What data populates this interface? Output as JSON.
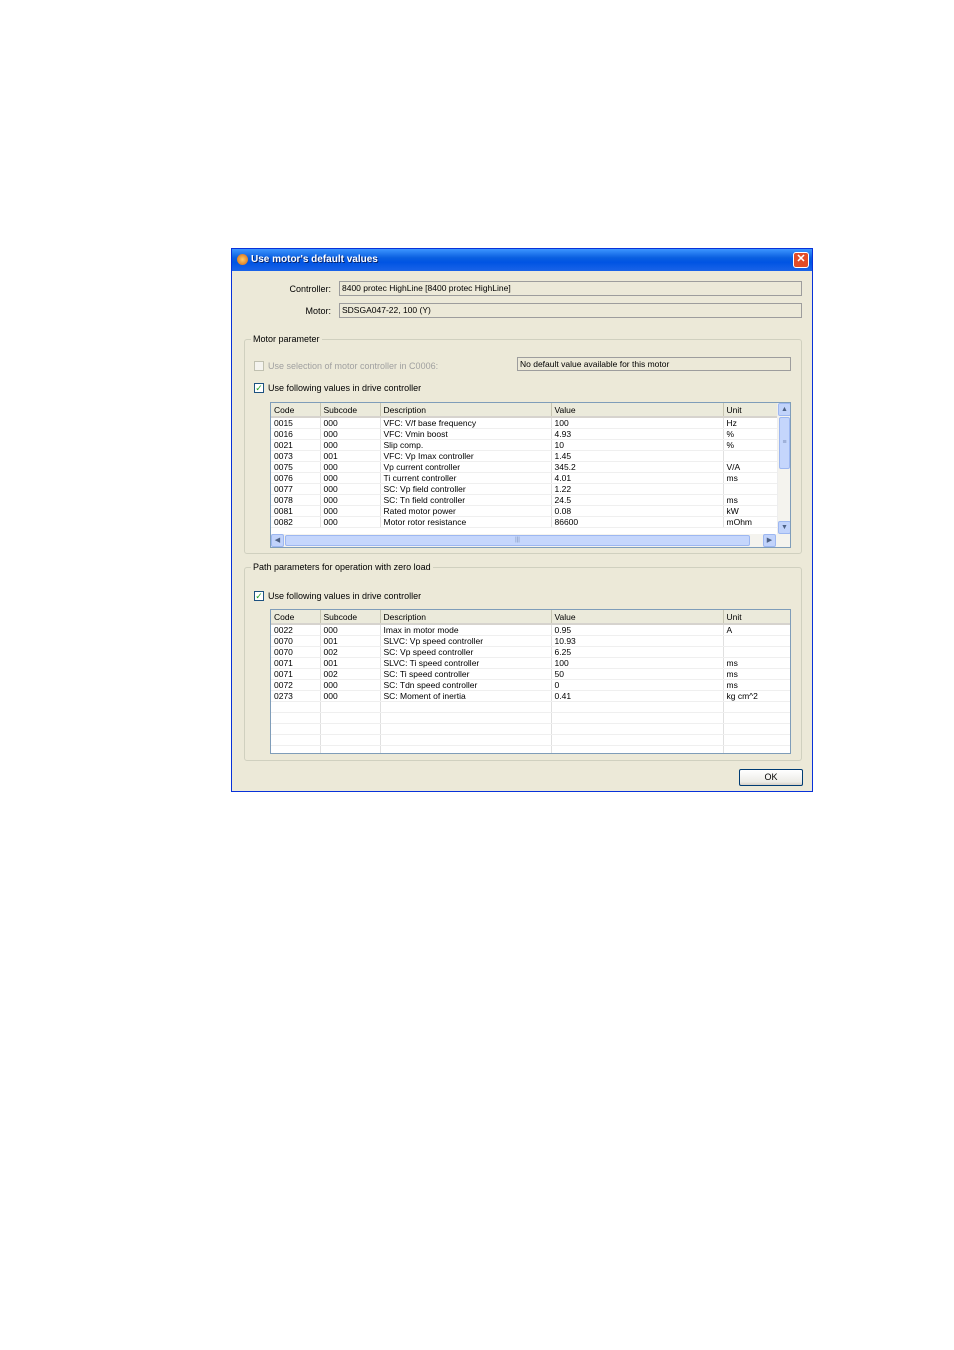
{
  "window": {
    "title": "Use motor's default values",
    "close_glyph": "✕"
  },
  "controller": {
    "label": "Controller:",
    "value": "8400 protec HighLine [8400 protec HighLine]"
  },
  "motor": {
    "label": "Motor:",
    "value": "SDSGA047-22, 100 (Y)"
  },
  "motor_parameter": {
    "group_title": "Motor parameter",
    "use_selection_label": "Use selection of motor controller in C0006:",
    "no_default_text": "No default value available for this motor",
    "use_values_label": "Use following values in drive controller",
    "columns": [
      "Code",
      "Subcode",
      "Description",
      "Value",
      "Unit"
    ],
    "rows": [
      [
        "0015",
        "000",
        "VFC: V/f base frequency",
        "100",
        "Hz"
      ],
      [
        "0016",
        "000",
        "VFC: Vmin boost",
        "4.93",
        "%"
      ],
      [
        "0021",
        "000",
        "Slip comp.",
        "10",
        "%"
      ],
      [
        "0073",
        "001",
        "VFC: Vp Imax controller",
        "1.45",
        ""
      ],
      [
        "0075",
        "000",
        "Vp current controller",
        "345.2",
        "V/A"
      ],
      [
        "0076",
        "000",
        "Ti current controller",
        "4.01",
        "ms"
      ],
      [
        "0077",
        "000",
        "SC: Vp field controller",
        "1.22",
        ""
      ],
      [
        "0078",
        "000",
        "SC: Tn field controller",
        "24.5",
        "ms"
      ],
      [
        "0081",
        "000",
        "Rated motor power",
        "0.08",
        "kW"
      ],
      [
        "0082",
        "000",
        "Motor rotor resistance",
        "86600",
        "mOhm"
      ]
    ],
    "scroll_up": "▲",
    "scroll_down": "▼",
    "scroll_left": "◀",
    "scroll_right": "▶",
    "grip": "≡",
    "hgrip": "|||"
  },
  "path_parameter": {
    "group_title": "Path parameters for operation with zero load",
    "use_values_label": "Use following values in drive controller",
    "columns": [
      "Code",
      "Subcode",
      "Description",
      "Value",
      "Unit"
    ],
    "rows": [
      [
        "0022",
        "000",
        "Imax in motor mode",
        "0.95",
        "A"
      ],
      [
        "0070",
        "001",
        "SLVC: Vp speed controller",
        "10.93",
        ""
      ],
      [
        "0070",
        "002",
        "SC: Vp speed controller",
        "6.25",
        ""
      ],
      [
        "0071",
        "001",
        "SLVC: Ti speed controller",
        "100",
        "ms"
      ],
      [
        "0071",
        "002",
        "SC: Ti speed controller",
        "50",
        "ms"
      ],
      [
        "0072",
        "000",
        "SC: Tdn speed controller",
        "0",
        "ms"
      ],
      [
        "0273",
        "000",
        "SC: Moment of inertia",
        "0.41",
        "kg cm^2"
      ]
    ],
    "empty_rows": 5
  },
  "check_glyph": "✓",
  "ok_button": "OK"
}
